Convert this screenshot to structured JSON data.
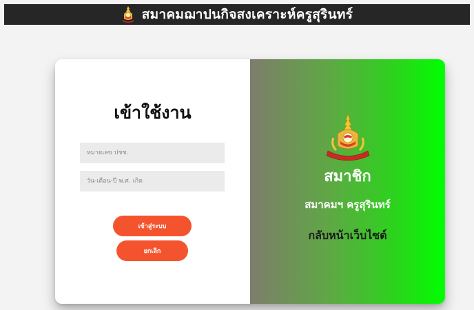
{
  "header": {
    "title": "สมาคมฌาปนกิจสงเคราะห์ครูสุรินทร์",
    "emblem_icon": "association-emblem-icon"
  },
  "login": {
    "heading": "เข้าใช้งาน",
    "id_placeholder": "หมายเลข ปชช.",
    "id_value": "",
    "dob_placeholder": "วัน-เดือน-ปี พ.ศ. เกิด",
    "dob_value": "",
    "submit_label": "เข้าสู่ระบบ",
    "cancel_label": "ยกเลิก"
  },
  "promo": {
    "emblem_icon": "association-emblem-icon",
    "member_title": "สมาชิก",
    "association_name": "สมาคมฯ ครูสุรินทร์",
    "back_link": "กลับหน้าเว็บไซต์"
  },
  "colors": {
    "header_bg": "#262626",
    "button": "#f4542d",
    "gradient_start": "#7d7d6b",
    "gradient_end": "#00ff00",
    "input_bg": "#ebebeb"
  }
}
